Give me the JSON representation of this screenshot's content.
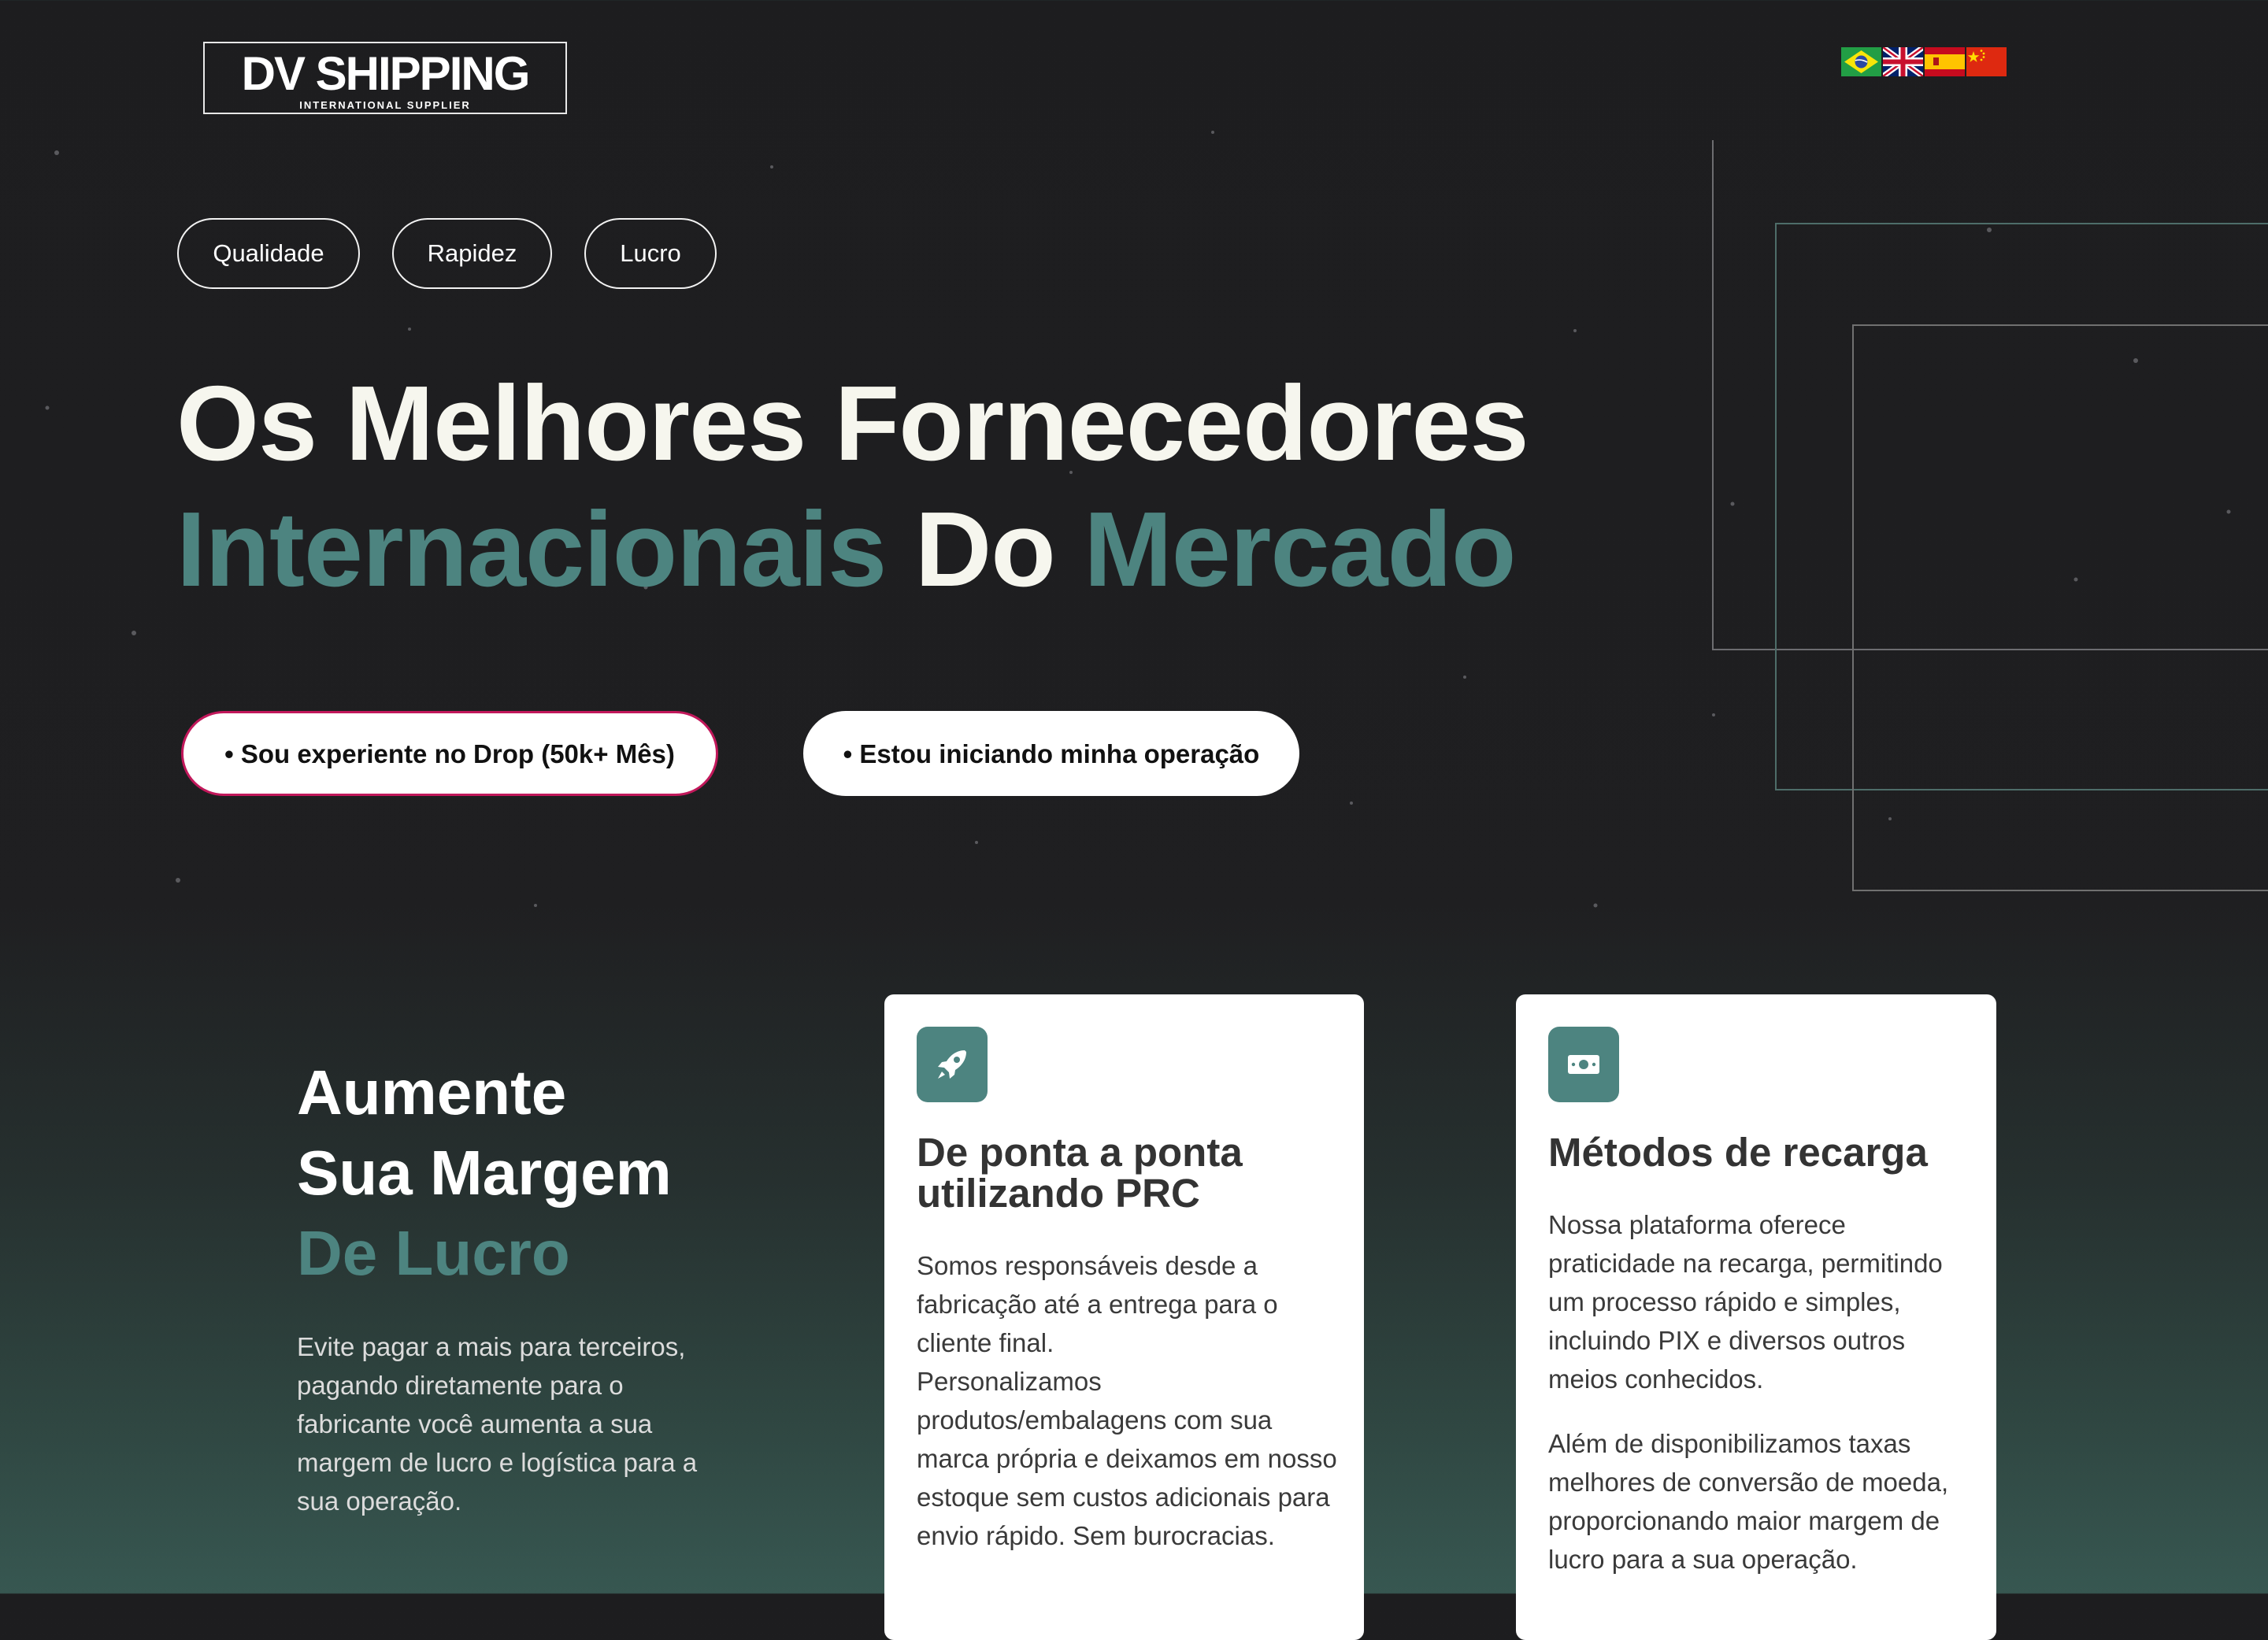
{
  "header": {
    "logo": {
      "main": "DV SHIPPING",
      "sub": "INTERNATIONAL SUPPLIER"
    },
    "languages": [
      {
        "name": "Português",
        "icon": "brazil-flag-icon"
      },
      {
        "name": "English",
        "icon": "uk-flag-icon"
      },
      {
        "name": "Español",
        "icon": "spain-flag-icon"
      },
      {
        "name": "中文",
        "icon": "china-flag-icon"
      }
    ]
  },
  "hero": {
    "tags": [
      "Qualidade",
      "Rapidez",
      "Lucro"
    ],
    "headline": {
      "line1": "Os Melhores Fornecedores",
      "word_internacionais": "Internacionais",
      "word_do": "Do",
      "word_mercado": "Mercado"
    },
    "cta": {
      "experienced": "• Sou experiente no Drop (50k+ Mês)",
      "beginner": "• Estou iniciando minha operação"
    }
  },
  "margin_section": {
    "title_line1": "Aumente",
    "title_line2": "Sua Margem",
    "title_line3": "De Lucro",
    "description": "Evite pagar a mais para terceiros, pagando diretamente para o fabricante você aumenta a sua margem de lucro e logística para a sua operação."
  },
  "cards": [
    {
      "icon": "rocket-icon",
      "title": "De ponta a ponta utilizando PRC",
      "paragraphs": [
        "Somos responsáveis desde a fabricação até a entrega para o cliente final.\nPersonalizamos produtos/embalagens com sua marca própria e deixamos em nosso estoque sem custos adicionais para envio rápido. Sem burocracias."
      ]
    },
    {
      "icon": "money-bill-icon",
      "title": "Métodos de recarga",
      "paragraphs": [
        "Nossa plataforma oferece praticidade na recarga, permitindo um processo rápido e simples, incluindo PIX e diversos outros meios conhecidos.",
        "Além de disponibilizamos taxas melhores de conversão de moeda, proporcionando maior margem de lucro para a sua operação."
      ]
    }
  ],
  "colors": {
    "accent_teal": "#4d8480",
    "background_dark": "#1d1d1f",
    "cta_border_pink": "#c2185b"
  }
}
